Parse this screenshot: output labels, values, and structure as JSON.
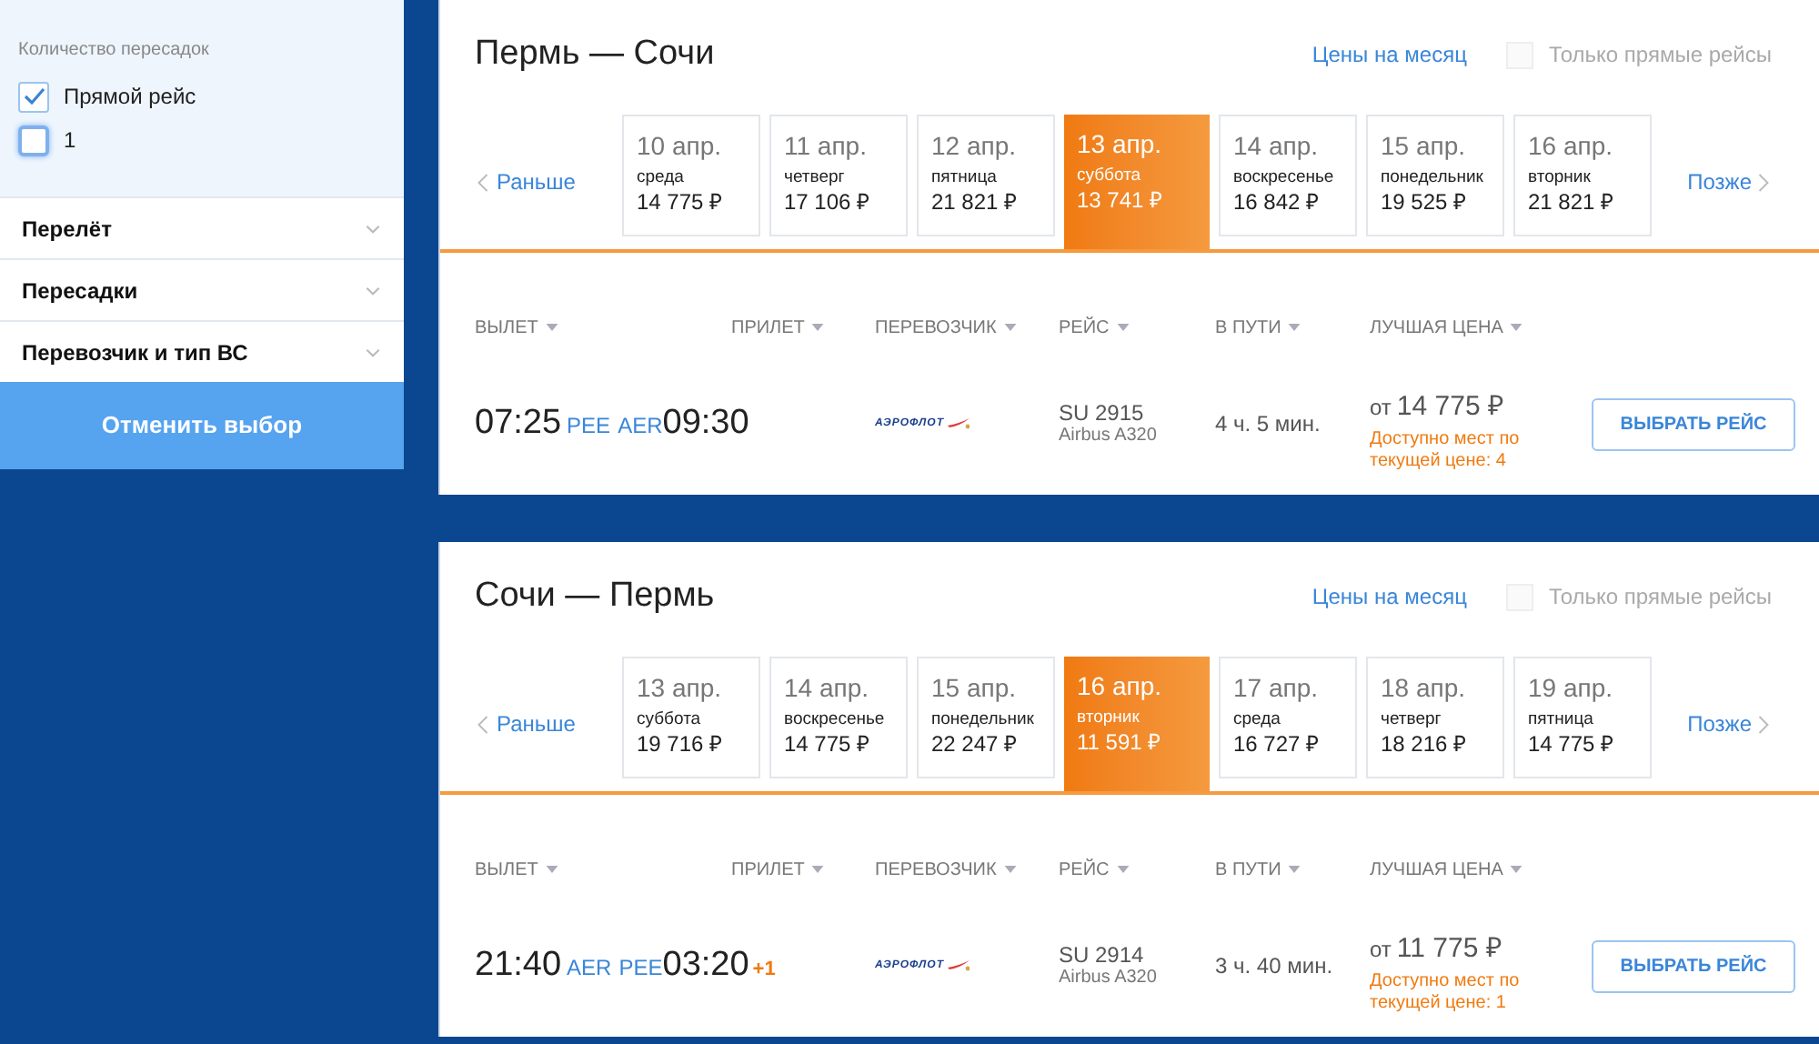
{
  "filters": {
    "section_label": "Количество пересадок",
    "options": [
      {
        "label": "Прямой рейс",
        "checked": true
      },
      {
        "label": "1",
        "checked": false
      }
    ],
    "accordions": [
      {
        "label": "Перелёт",
        "expanded": false
      },
      {
        "label": "Пересадки",
        "expanded": false
      },
      {
        "label": "Перевозчик и тип ВС",
        "expanded": false
      }
    ],
    "reset_button": "Отменить выбор"
  },
  "flights": [
    {
      "route": "Пермь — Сочи",
      "month_prices_link": "Цены на месяц",
      "direct_only": {
        "label": "Только прямые рейсы",
        "checked": false
      },
      "earlier": "Раньше",
      "later": "Позже",
      "dates": [
        {
          "date": "10 апр.",
          "weekday": "среда",
          "price": "14 775 ₽",
          "selected": false
        },
        {
          "date": "11 апр.",
          "weekday": "четверг",
          "price": "17 106 ₽",
          "selected": false
        },
        {
          "date": "12 апр.",
          "weekday": "пятница",
          "price": "21 821 ₽",
          "selected": false
        },
        {
          "date": "13 апр.",
          "weekday": "суббота",
          "price": "13 741 ₽",
          "selected": true
        },
        {
          "date": "14 апр.",
          "weekday": "воскресенье",
          "price": "16 842 ₽",
          "selected": false
        },
        {
          "date": "15 апр.",
          "weekday": "понедельник",
          "price": "19 525 ₽",
          "selected": false
        },
        {
          "date": "16 апр.",
          "weekday": "вторник",
          "price": "21 821 ₽",
          "selected": false
        }
      ],
      "columns": [
        "ВЫЛЕТ",
        "ПРИЛЕТ",
        "ПЕРЕВОЗЧИК",
        "РЕЙС",
        "В ПУТИ",
        "ЛУЧШАЯ ЦЕНА"
      ],
      "row": {
        "depart_time": "07:25",
        "from": "PEE",
        "to": "AER",
        "arrive_time": "09:30",
        "carrier": "АЭРОФЛОТ",
        "flight_number": "SU 2915",
        "aircraft": "Airbus A320",
        "duration": "4 ч. 5 мин.",
        "price_prefix": "от",
        "price": "14 775 ₽",
        "availability": "Доступно мест по текущей цене: 4",
        "select_button": "ВЫБРАТЬ РЕЙС"
      }
    },
    {
      "route": "Сочи — Пермь",
      "month_prices_link": "Цены на месяц",
      "direct_only": {
        "label": "Только прямые рейсы",
        "checked": false
      },
      "earlier": "Раньше",
      "later": "Позже",
      "dates": [
        {
          "date": "13 апр.",
          "weekday": "суббота",
          "price": "19 716 ₽",
          "selected": false
        },
        {
          "date": "14 апр.",
          "weekday": "воскресенье",
          "price": "14 775 ₽",
          "selected": false
        },
        {
          "date": "15 апр.",
          "weekday": "понедельник",
          "price": "22 247 ₽",
          "selected": false
        },
        {
          "date": "16 апр.",
          "weekday": "вторник",
          "price": "11 591 ₽",
          "selected": true
        },
        {
          "date": "17 апр.",
          "weekday": "среда",
          "price": "16 727 ₽",
          "selected": false
        },
        {
          "date": "18 апр.",
          "weekday": "четверг",
          "price": "18 216 ₽",
          "selected": false
        },
        {
          "date": "19 апр.",
          "weekday": "пятница",
          "price": "14 775 ₽",
          "selected": false
        }
      ],
      "columns": [
        "ВЫЛЕТ",
        "ПРИЛЕТ",
        "ПЕРЕВОЗЧИК",
        "РЕЙС",
        "В ПУТИ",
        "ЛУЧШАЯ ЦЕНА"
      ],
      "row": {
        "depart_time": "21:40",
        "from": "AER",
        "to": "PEE",
        "arrive_time": "03:20",
        "day_offset": "+1",
        "carrier": "АЭРОФЛОТ",
        "flight_number": "SU 2914",
        "aircraft": "Airbus A320",
        "duration": "3 ч. 40 мин.",
        "price_prefix": "от",
        "price": "11 775 ₽",
        "availability": "Доступно мест по текущей цене: 1",
        "select_button": "ВЫБРАТЬ РЕЙС"
      }
    }
  ]
}
